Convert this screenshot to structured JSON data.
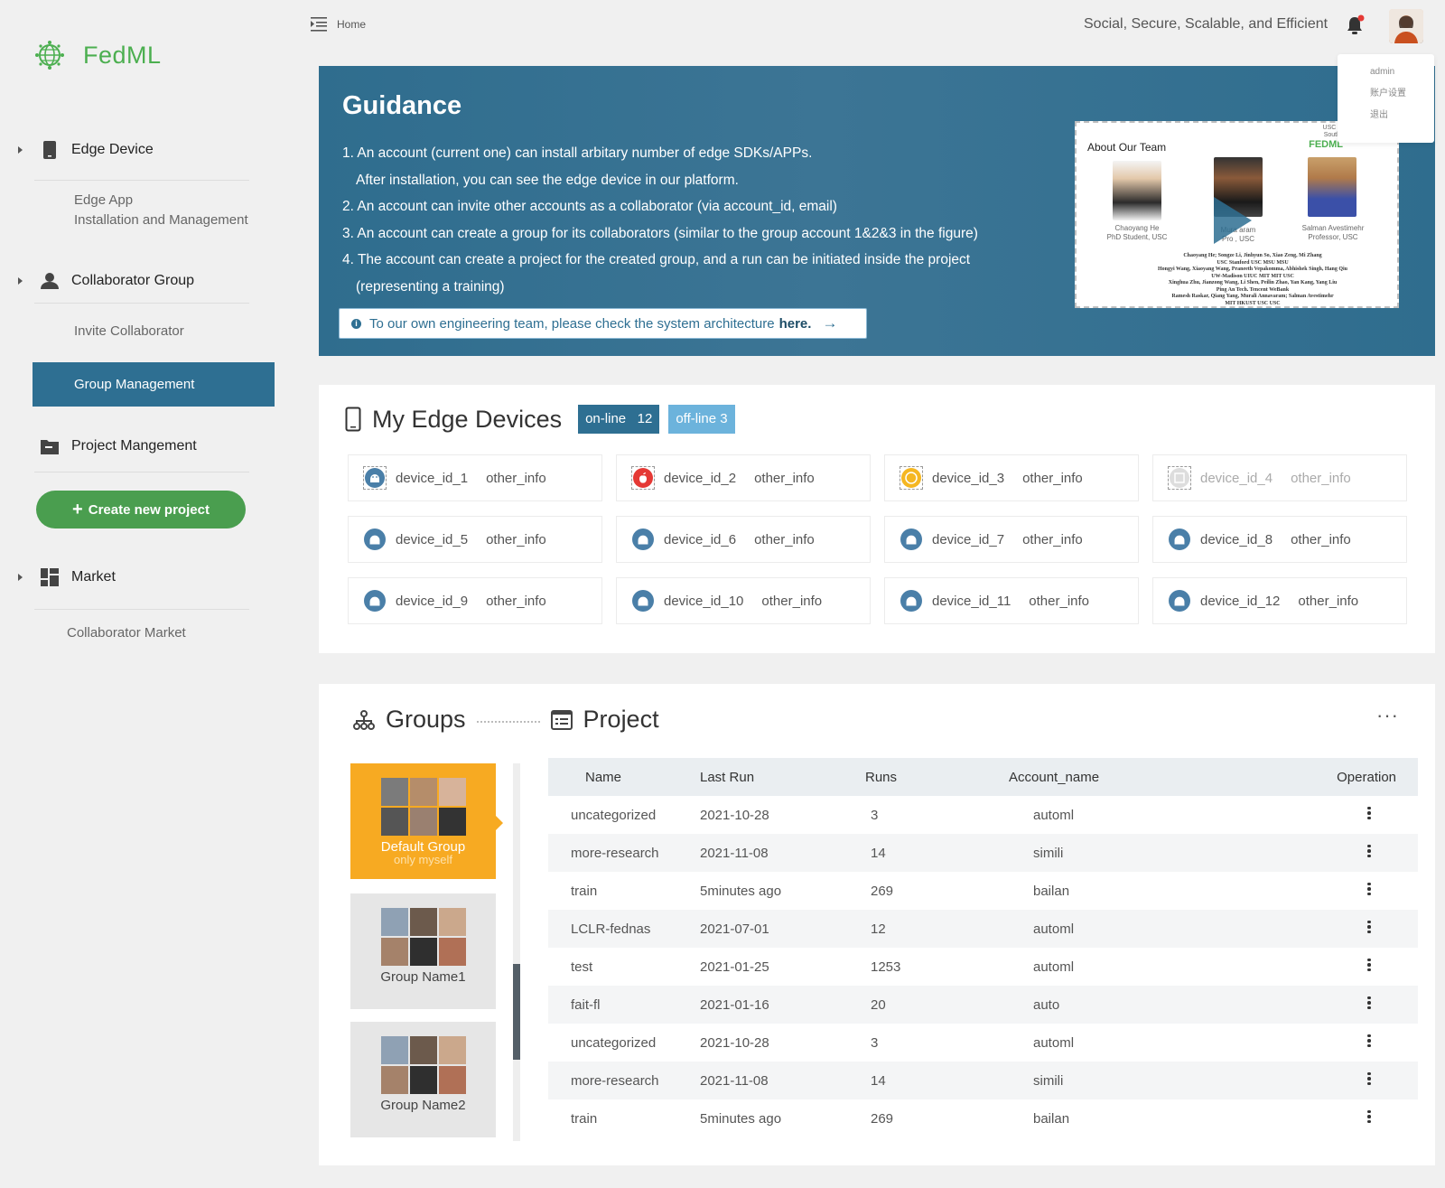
{
  "brand": {
    "name": "FedML",
    "color": "#4caf50"
  },
  "header": {
    "home": "Home",
    "tagline": "Social, Secure, Scalable, and Efficient",
    "bell_icon": "bell-icon"
  },
  "user_menu": {
    "items": [
      "admin",
      "账户设置",
      "退出"
    ]
  },
  "sidebar": {
    "edge_device": {
      "label": "Edge Device",
      "sub1": "Edge App",
      "sub2": "Installation and Management"
    },
    "collaborator_group": {
      "label": "Collaborator Group",
      "invite": "Invite Collaborator",
      "group_mgmt": "Group Management"
    },
    "project": {
      "label": "Project Mangement",
      "create": "Create new project"
    },
    "market": {
      "label": "Market",
      "collab_market": "Collaborator Market"
    },
    "accent": "#2e6f92"
  },
  "guidance": {
    "title": "Guidance",
    "lines": [
      "1. An account (current one) can install arbitary number of edge SDKs/APPs.",
      "After installation, you can see the edge device in our platform.",
      "2. An account can invite other accounts as a collaborator (via account_id, email)",
      "3. An account can create a group for its collaborators (similar to the group account 1&2&3 in the figure)",
      "4. The account can create a project for the created group, and a run can be initiated inside the project",
      "(representing a training)"
    ],
    "notice_text": "To our own engineering team, please check the system architecture",
    "notice_link": "here.",
    "team": {
      "title": "About Our Team",
      "usc1": "USC University",
      "usc2": "Southern Calif.",
      "fedml": "FEDML",
      "p1_name": "Chaoyang He",
      "p1_role": "PhD Student, USC",
      "p2_name": "Mura      aram",
      "p2_role": "Pro      , USC",
      "p3_name": "Salman Avestimehr",
      "p3_role": "Professor, USC",
      "names_1": "Chaoyang He;  Songze Li,  Jinhyun So,  Xiao Zeng,  Mi Zhang",
      "names_2": "USC    Stanford    USC    MSU    MSU",
      "names_3": "Hongyi Wang,  Xiaoyang Wang,  Praneeth Vepakomma,  Abhishek Singh,  Hang Qiu",
      "names_4": "UW-Madison    UIUC    MIT    MIT    USC",
      "names_5": "Xinghua Zhu, Jianzong Wang,  Li Shen, Peilin Zhao,  Yan Kang, Yang Liu",
      "names_6": "Ping An Tech.    Tencent    WeBank",
      "names_7": "Ramesh Raskar,  Qiang Yang,  Murali Annavaram;  Salman Avestimehr",
      "names_8": "MIT    HKUST    USC    USC"
    }
  },
  "devices": {
    "title": "My Edge Devices",
    "online_label": "on-line",
    "online_count": "12",
    "offline_label": "off-line 3",
    "items": [
      {
        "id": "device_id_1",
        "info": "other_info"
      },
      {
        "id": "device_id_2",
        "info": "other_info"
      },
      {
        "id": "device_id_3",
        "info": "other_info"
      },
      {
        "id": "device_id_4",
        "info": "other_info"
      },
      {
        "id": "device_id_5",
        "info": "other_info"
      },
      {
        "id": "device_id_6",
        "info": "other_info"
      },
      {
        "id": "device_id_7",
        "info": "other_info"
      },
      {
        "id": "device_id_8",
        "info": "other_info"
      },
      {
        "id": "device_id_9",
        "info": "other_info"
      },
      {
        "id": "device_id_10",
        "info": "other_info"
      },
      {
        "id": "device_id_11",
        "info": "other_info"
      },
      {
        "id": "device_id_12",
        "info": "other_info"
      }
    ]
  },
  "groups": {
    "title": "Groups",
    "project_title": "Project",
    "cards": [
      {
        "name": "Default Group",
        "sub": "only myself"
      },
      {
        "name": "Group Name1"
      },
      {
        "name": "Group Name2"
      }
    ],
    "active_color": "#f7aa22"
  },
  "table": {
    "headers": [
      "Name",
      "Last Run",
      "Runs",
      "Account_name",
      "Operation"
    ],
    "rows": [
      [
        "uncategorized",
        "2021-10-28",
        "3",
        "automl"
      ],
      [
        "more-research",
        "2021-11-08",
        "14",
        "simili"
      ],
      [
        "train",
        "5minutes ago",
        "269",
        "bailan"
      ],
      [
        "LCLR-fednas",
        "2021-07-01",
        "12",
        "automl"
      ],
      [
        "test",
        "2021-01-25",
        "1253",
        "automl"
      ],
      [
        "fait-fl",
        "2021-01-16",
        "20",
        "auto"
      ],
      [
        "uncategorized",
        "2021-10-28",
        "3",
        "automl"
      ],
      [
        "more-research",
        "2021-11-08",
        "14",
        "simili"
      ],
      [
        "train",
        "5minutes ago",
        "269",
        "bailan"
      ]
    ]
  }
}
